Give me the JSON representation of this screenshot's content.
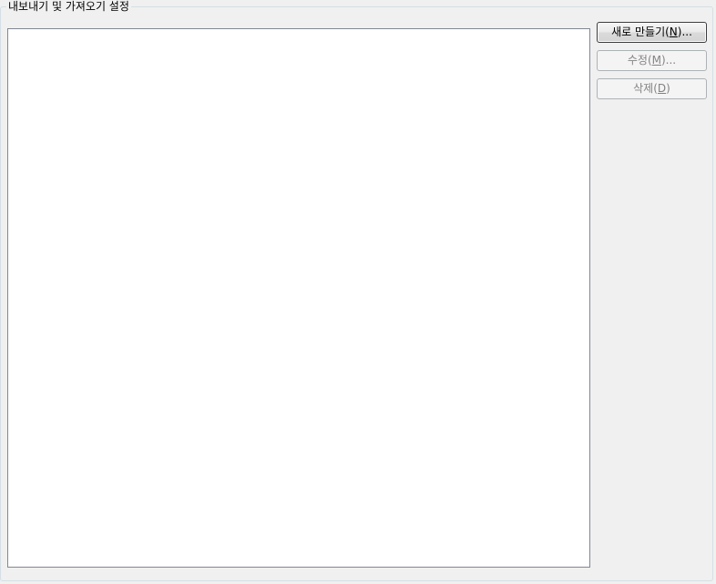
{
  "group": {
    "title": "내보내기 및 가져오기 설정"
  },
  "list": {
    "items": []
  },
  "buttons": {
    "new": {
      "prefix": "새로 만들기(",
      "mnemonic": "N",
      "suffix": ")...",
      "enabled": true
    },
    "edit": {
      "prefix": "수정(",
      "mnemonic": "M",
      "suffix": ")...",
      "enabled": false
    },
    "delete": {
      "prefix": "삭제(",
      "mnemonic": "D",
      "suffix": ")",
      "enabled": false
    }
  }
}
